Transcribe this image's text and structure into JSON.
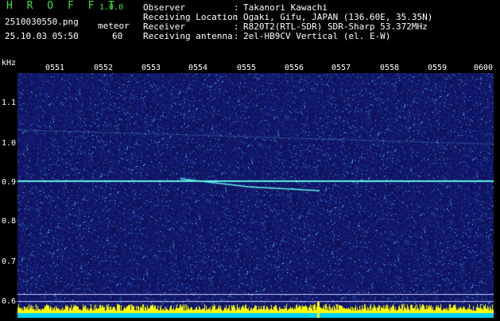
{
  "app": {
    "title": "H R O F F T",
    "version": "1.0.0"
  },
  "file": {
    "name": "2510030550.png",
    "datetime": "25.10.03 05:50"
  },
  "meteor": {
    "label": "meteor",
    "count": "60"
  },
  "info": [
    {
      "label": "Observer",
      "value": "Takanori Kawachi"
    },
    {
      "label": "Receiving Location",
      "value": "Ogaki, Gifu, JAPAN (136.60E, 35.35N)"
    },
    {
      "label": "Receiver",
      "value": "R820T2(RTL-SDR) SDR-Sharp 53.372MHz"
    },
    {
      "label": "Receiving antenna",
      "value": "2el-HB9CV Vertical (el. E-W)"
    }
  ],
  "colon": ":",
  "yaxis": {
    "unit": "kHz",
    "ticks": [
      "1.1",
      "1.0",
      "0.9",
      "0.8",
      "0.7",
      "0.6"
    ]
  },
  "xaxis": {
    "ticks": [
      "0551",
      "0552",
      "0553",
      "0554",
      "0555",
      "0556",
      "0557",
      "0558",
      "0559",
      "0600"
    ]
  },
  "colors": {
    "background": "#000000",
    "waterfall": "#10125e",
    "trace": "#5ff0e6",
    "title": "#3ce63c",
    "baseline": "#ffff00"
  }
}
